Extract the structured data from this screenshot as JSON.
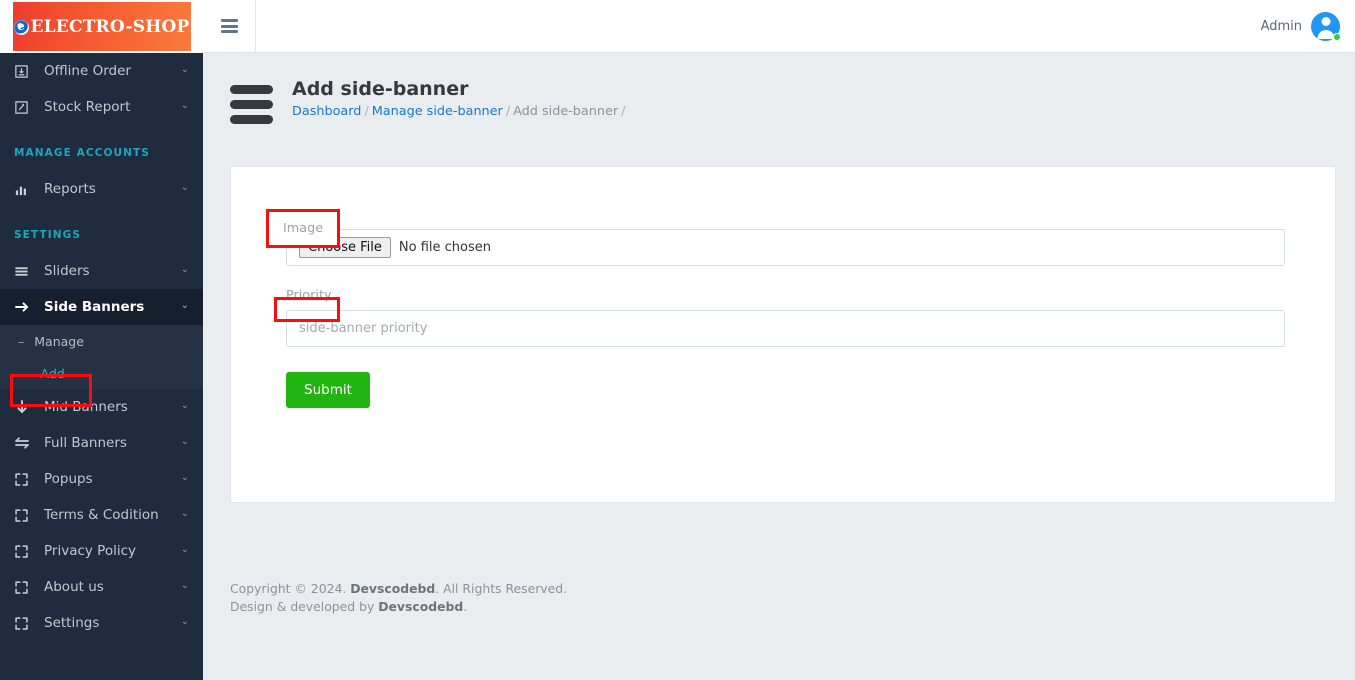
{
  "brand": {
    "text": "ELECTRO-SHOP",
    "icon": "e-globe-icon"
  },
  "sidebar": {
    "items": [
      {
        "label": "Offline Order",
        "icon": "download-box-icon",
        "caret": "⌄"
      },
      {
        "label": "Stock Report",
        "icon": "edit-square-icon",
        "caret": "⌄"
      }
    ],
    "section_manage_accounts": "MANAGE ACCOUNTS",
    "items2": [
      {
        "label": "Reports",
        "icon": "bar-chart-icon",
        "caret": "⌄"
      }
    ],
    "section_settings": "SETTINGS",
    "items3": [
      {
        "label": "Sliders",
        "icon": "bars-icon",
        "caret": "⌄"
      },
      {
        "label": "Side Banners",
        "icon": "arrow-right-icon",
        "caret": "⌄"
      }
    ],
    "submenu": [
      {
        "label": "Manage",
        "dash": "–"
      },
      {
        "label": "Add",
        "dash": "—"
      }
    ],
    "items4": [
      {
        "label": "Mid Banners",
        "icon": "arrow-down-icon",
        "caret": "⌄"
      },
      {
        "label": "Full Banners",
        "icon": "arrows-left-right-icon",
        "caret": "⌄"
      },
      {
        "label": "Popups",
        "icon": "expand-icon",
        "caret": "⌄"
      },
      {
        "label": "Terms & Codition",
        "icon": "expand-icon",
        "caret": "⌄"
      },
      {
        "label": "Privacy Policy",
        "icon": "expand-icon",
        "caret": "⌄"
      },
      {
        "label": "About us",
        "icon": "expand-icon",
        "caret": "⌄"
      },
      {
        "label": "Settings",
        "icon": "expand-icon",
        "caret": "⌄"
      }
    ]
  },
  "topbar": {
    "menu_icon": "hamburger-icon",
    "admin_label": "Admin",
    "avatar_icon": "user-avatar-icon",
    "status": "online"
  },
  "page": {
    "title": "Add side-banner",
    "breadcrumb": {
      "dashboard": "Dashboard",
      "manage": "Manage side-banner",
      "current": "Add side-banner",
      "sep": "/"
    }
  },
  "form": {
    "image_label": "Image",
    "file_button": "Choose File",
    "file_status": "No file chosen",
    "priority_label": "Priority",
    "priority_placeholder": "side-banner priority",
    "priority_value": "",
    "submit_label": "Submit"
  },
  "footer": {
    "line1_a": "Copyright © 2024. ",
    "line1_b": "Devscodebd",
    "line1_c": ". All Rights Reserved.",
    "line2_a": "Design & developed by ",
    "line2_b": "Devscodebd",
    "line2_c": "."
  },
  "colors": {
    "sidebar_bg": "#1f2b3e",
    "sidebar_active": "#161f2e",
    "submenu_bg": "#253244",
    "accent_teal": "#17c3d6",
    "brand_gradient_from": "#ee3b2f",
    "brand_gradient_to": "#fa7a3c",
    "link_blue": "#1876d1",
    "submit_green": "#22b411",
    "annotation_red": "#fb0d0d",
    "status_green": "#2ecc40"
  }
}
